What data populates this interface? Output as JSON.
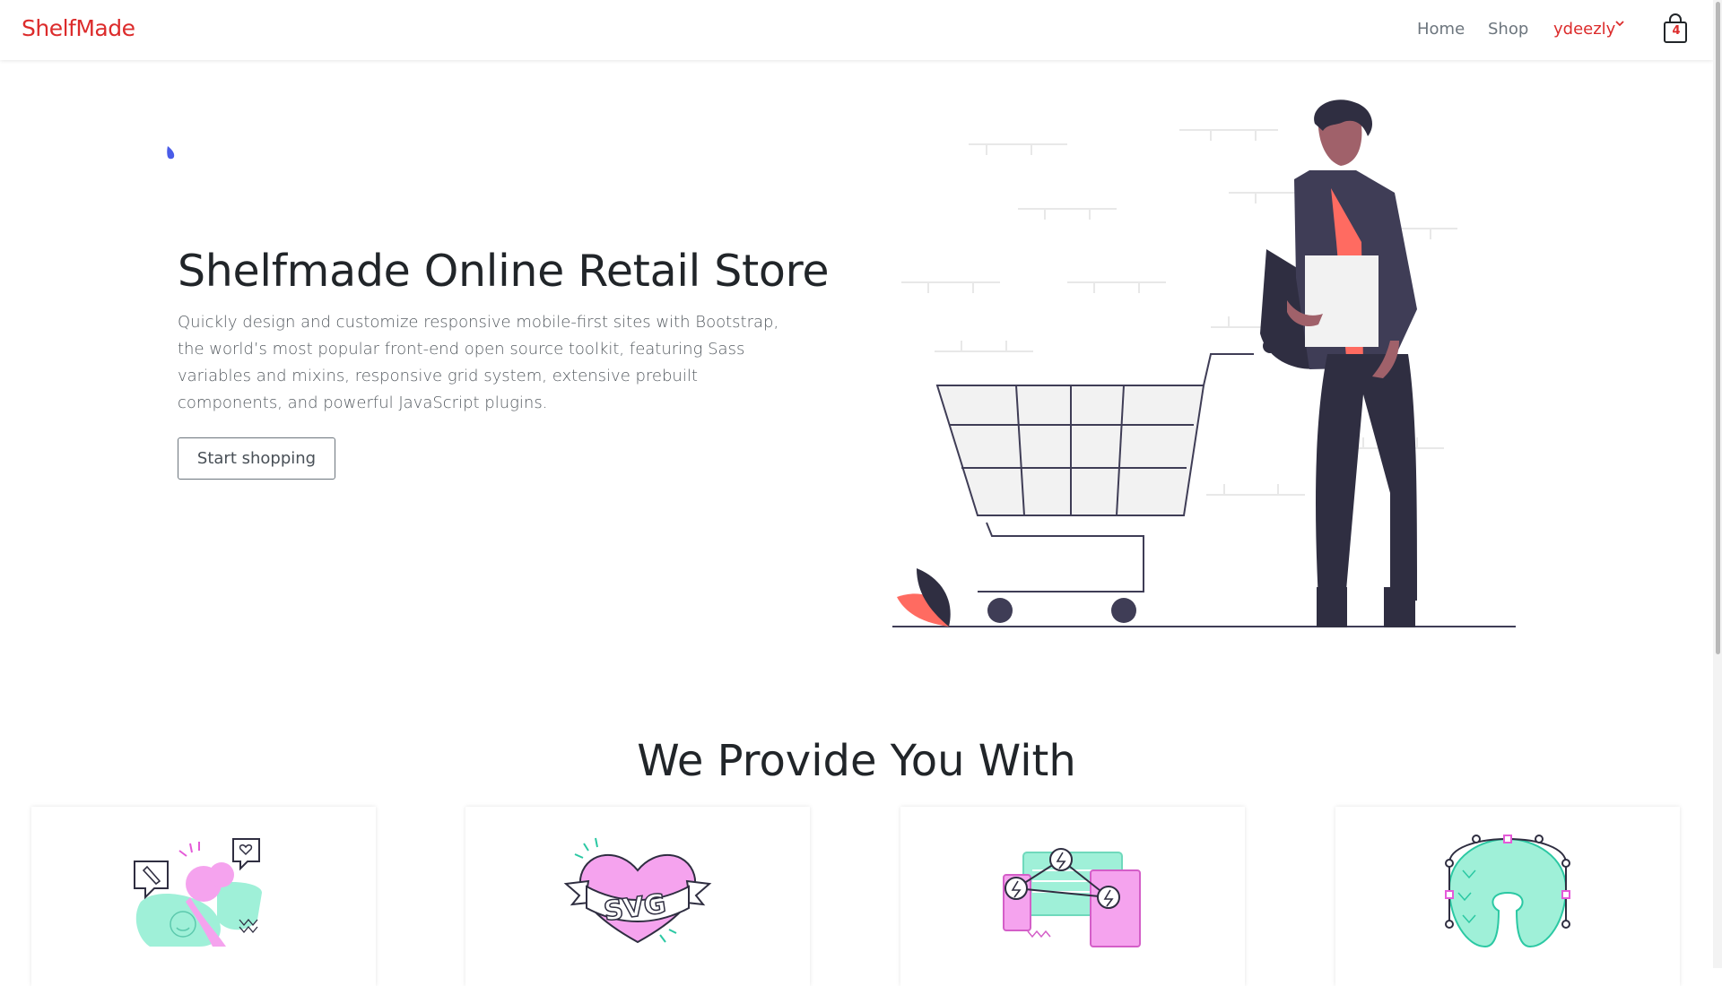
{
  "navbar": {
    "brand": "ShelfMade",
    "links": [
      {
        "label": "Home"
      },
      {
        "label": "Shop"
      }
    ],
    "user": {
      "label": "ydeezly",
      "icon": "chevron-down-icon"
    },
    "cart": {
      "icon": "shopping-bag-icon",
      "count": "4"
    }
  },
  "hero": {
    "title": "Shelfmade Online Retail Store",
    "description": "Quickly design and customize responsive mobile-first sites with Bootstrap, the world’s most popular front-end open source toolkit, featuring Sass variables and mixins, responsive grid system, extensive prebuilt components, and powerful JavaScript plugins.",
    "button_label": "Start shopping",
    "illustration": "shopping-cart-person-illustration"
  },
  "features": {
    "title": "We Provide You With",
    "cards": [
      {
        "icon": "social-chat-illustration-icon"
      },
      {
        "icon": "svg-heart-illustration-icon"
      },
      {
        "icon": "connected-devices-illustration-icon"
      },
      {
        "icon": "vector-shape-illustration-icon"
      }
    ]
  },
  "colors": {
    "brand": "#dc2b2b",
    "text": "#212529",
    "muted": "#6c757d",
    "accent_pink": "#f5a3ee",
    "accent_mint": "#9ff0d8",
    "illustration_dark": "#2f2e41",
    "illustration_coral": "#ff6b61"
  }
}
